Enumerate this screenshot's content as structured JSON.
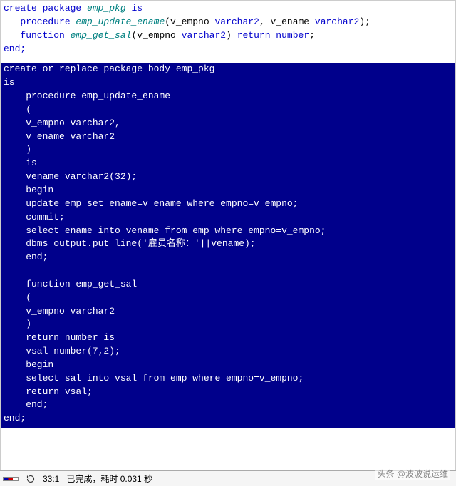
{
  "spec": {
    "line1_a": "create",
    "line1_b": " package ",
    "line1_c": "emp_pkg",
    "line1_d": " is",
    "line2_a": "   procedure ",
    "line2_b": "emp_update_ename",
    "line2_c": "(v_empno ",
    "line2_d": "varchar2",
    "line2_e": ", v_ename ",
    "line2_f": "varchar2",
    "line2_g": ");",
    "line3_a": "   function ",
    "line3_b": "emp_get_sal",
    "line3_c": "(v_empno ",
    "line3_d": "varchar2",
    "line3_e": ") ",
    "line3_f": "return number",
    "line3_g": ";",
    "line4": "end;"
  },
  "body": {
    "lines": [
      "create or replace package body emp_pkg",
      "is",
      "    procedure emp_update_ename",
      "    (",
      "    v_empno varchar2,",
      "    v_ename varchar2",
      "    )",
      "    is",
      "    vename varchar2(32);",
      "    begin",
      "    update emp set ename=v_ename where empno=v_empno;",
      "    commit;",
      "    select ename into vename from emp where empno=v_empno;",
      "    dbms_output.put_line('雇员名称：'||vename);",
      "    end;",
      "",
      "    function emp_get_sal",
      "    (",
      "    v_empno varchar2",
      "    )",
      "    return number is",
      "    vsal number(7,2);",
      "    begin",
      "    select sal into vsal from emp where empno=v_empno;",
      "    return vsal;",
      "    end;",
      "end;"
    ]
  },
  "status": {
    "cursor": "33:1",
    "message": "已完成，耗时 0.031 秒"
  },
  "watermark": {
    "prefix": "头条 ",
    "handle": "@波波说运维"
  }
}
